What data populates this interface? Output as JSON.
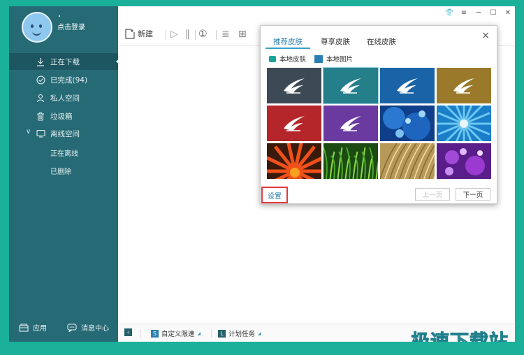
{
  "user": {
    "login_label": "点击登录"
  },
  "sidebar": {
    "items": [
      {
        "label": "正在下载",
        "icon": "download-icon"
      },
      {
        "label": "已完成(94)",
        "icon": "check-circle-icon"
      },
      {
        "label": "私人空间",
        "icon": "person-icon"
      },
      {
        "label": "垃圾箱",
        "icon": "trash-icon"
      },
      {
        "label": "离线空间",
        "icon": "cloud-icon"
      }
    ],
    "sub_items": [
      "正在离线",
      "已删除"
    ],
    "bottom": {
      "apps": "应用",
      "messages": "消息中心"
    }
  },
  "toolbar": {
    "new_label": "新建"
  },
  "bottom_bar": {
    "speed_label": "自定义限速",
    "schedule_label": "计划任务"
  },
  "skin_dialog": {
    "tabs": [
      "推荐皮肤",
      "尊享皮肤",
      "在线皮肤"
    ],
    "local_skin": "本地皮肤",
    "local_picture": "本地图片",
    "settings_link": "设置",
    "prev_page": "上一页",
    "next_page": "下一页",
    "close": "×",
    "thumbnails": [
      {
        "name": "dark-slate",
        "color": "#3d4a55"
      },
      {
        "name": "teal",
        "color": "#257f8b"
      },
      {
        "name": "blue",
        "color": "#1a63a6"
      },
      {
        "name": "olive-gold",
        "color": "#9a7a2a"
      },
      {
        "name": "red",
        "color": "#b5262a"
      },
      {
        "name": "purple",
        "color": "#6a3aa0"
      },
      {
        "name": "blue-water-drops",
        "color": "#1755b0"
      },
      {
        "name": "blue-flower",
        "color": "#2ea0dc"
      },
      {
        "name": "orange-flower",
        "color": "#e0401a"
      },
      {
        "name": "green-grass",
        "color": "#2f8a2a"
      },
      {
        "name": "golden-grass",
        "color": "#c8a860"
      },
      {
        "name": "purple-drops",
        "color": "#8a3ac0"
      }
    ]
  },
  "watermark": "极速下载站"
}
